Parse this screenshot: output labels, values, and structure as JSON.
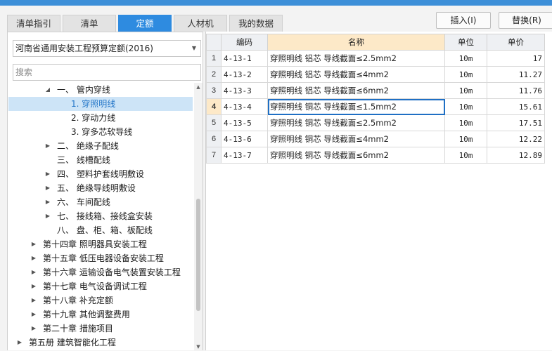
{
  "tabs": [
    {
      "label": "清单指引"
    },
    {
      "label": "清单"
    },
    {
      "label": "定额"
    },
    {
      "label": "人材机"
    },
    {
      "label": "我的数据"
    }
  ],
  "toolbar": {
    "insert_label": "插入(I)",
    "replace_label": "替换(R)"
  },
  "left": {
    "quota_select": "河南省通用安装工程预算定额(2016)",
    "search_placeholder": "搜索",
    "tree": [
      {
        "label": "一、 管内穿线",
        "expanded": true
      },
      {
        "label": "1. 穿照明线",
        "selected": true
      },
      {
        "label": "2. 穿动力线"
      },
      {
        "label": "3. 穿多芯软导线"
      },
      {
        "label": "二、 绝缘子配线",
        "expanded": false
      },
      {
        "label": "三、 线槽配线"
      },
      {
        "label": "四、 塑料护套线明敷设",
        "expanded": false
      },
      {
        "label": "五、 绝缘导线明敷设",
        "expanded": false
      },
      {
        "label": "六、 车间配线",
        "expanded": false
      },
      {
        "label": "七、 接线箱、接线盒安装",
        "expanded": false
      },
      {
        "label": "八、 盘、柜、箱、板配线"
      },
      {
        "label": "第十四章 照明器具安装工程",
        "expanded": false
      },
      {
        "label": "第十五章 低压电器设备安装工程",
        "expanded": false
      },
      {
        "label": "第十六章 运输设备电气装置安装工程",
        "expanded": false
      },
      {
        "label": "第十七章 电气设备调试工程",
        "expanded": false
      },
      {
        "label": "第十八章 补充定额",
        "expanded": false
      },
      {
        "label": "第十九章 其他调整费用",
        "expanded": false
      },
      {
        "label": "第二十章 措施项目",
        "expanded": false
      },
      {
        "label": "第五册 建筑智能化工程",
        "expanded": false
      }
    ]
  },
  "grid": {
    "headers": {
      "code": "编码",
      "name": "名称",
      "unit": "单位",
      "price": "单价"
    },
    "rows": [
      {
        "no": "1",
        "code": "4-13-1",
        "name": "穿照明线 铝芯 导线截面≤2.5mm2",
        "unit": "10m",
        "price": "17"
      },
      {
        "no": "2",
        "code": "4-13-2",
        "name": "穿照明线 铝芯 导线截面≤4mm2",
        "unit": "10m",
        "price": "11.27"
      },
      {
        "no": "3",
        "code": "4-13-3",
        "name": "穿照明线 铝芯 导线截面≤6mm2",
        "unit": "10m",
        "price": "11.76"
      },
      {
        "no": "4",
        "code": "4-13-4",
        "name": "穿照明线 铜芯 导线截面≤1.5mm2",
        "unit": "10m",
        "price": "15.61",
        "current": true
      },
      {
        "no": "5",
        "code": "4-13-5",
        "name": "穿照明线 铜芯 导线截面≤2.5mm2",
        "unit": "10m",
        "price": "17.51"
      },
      {
        "no": "6",
        "code": "4-13-6",
        "name": "穿照明线 铜芯 导线截面≤4mm2",
        "unit": "10m",
        "price": "12.22"
      },
      {
        "no": "7",
        "code": "4-13-7",
        "name": "穿照明线 铜芯 导线截面≤6mm2",
        "unit": "10m",
        "price": "12.89"
      }
    ]
  },
  "colors": {
    "accent": "#2e8be0",
    "selection": "#cde4f7",
    "header_highlight": "#fde9c8"
  }
}
